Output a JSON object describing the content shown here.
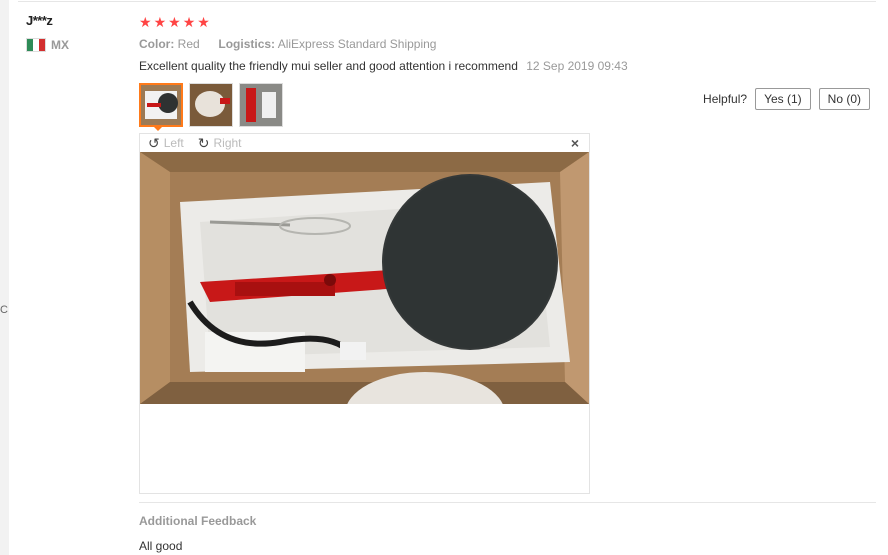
{
  "page_edge_text": "C",
  "user": {
    "name": "J***z",
    "country_code": "MX",
    "flag_colors": [
      "#2e8b57",
      "#ffffff",
      "#d32f2f"
    ]
  },
  "rating": {
    "stars": 5,
    "star_glyph": "★",
    "color": "#ff4444"
  },
  "meta": {
    "color_label": "Color:",
    "color_value": "Red",
    "logistics_label": "Logistics:",
    "logistics_value": "AliExpress Standard Shipping"
  },
  "review": {
    "text": "Excellent quality the friendly mui seller and good attention i recommend",
    "date": "12 Sep 2019 09:43"
  },
  "thumbnails": {
    "count": 3,
    "active_index": 0
  },
  "helpful": {
    "label": "Helpful?",
    "yes": "Yes (1)",
    "no": "No (0)"
  },
  "viewer": {
    "rotate_left": "Left",
    "rotate_right": "Right",
    "close_glyph": "×",
    "rotate_left_icon": "↺",
    "rotate_right_icon": "↻"
  },
  "additional": {
    "title": "Additional Feedback",
    "text": "All good"
  }
}
